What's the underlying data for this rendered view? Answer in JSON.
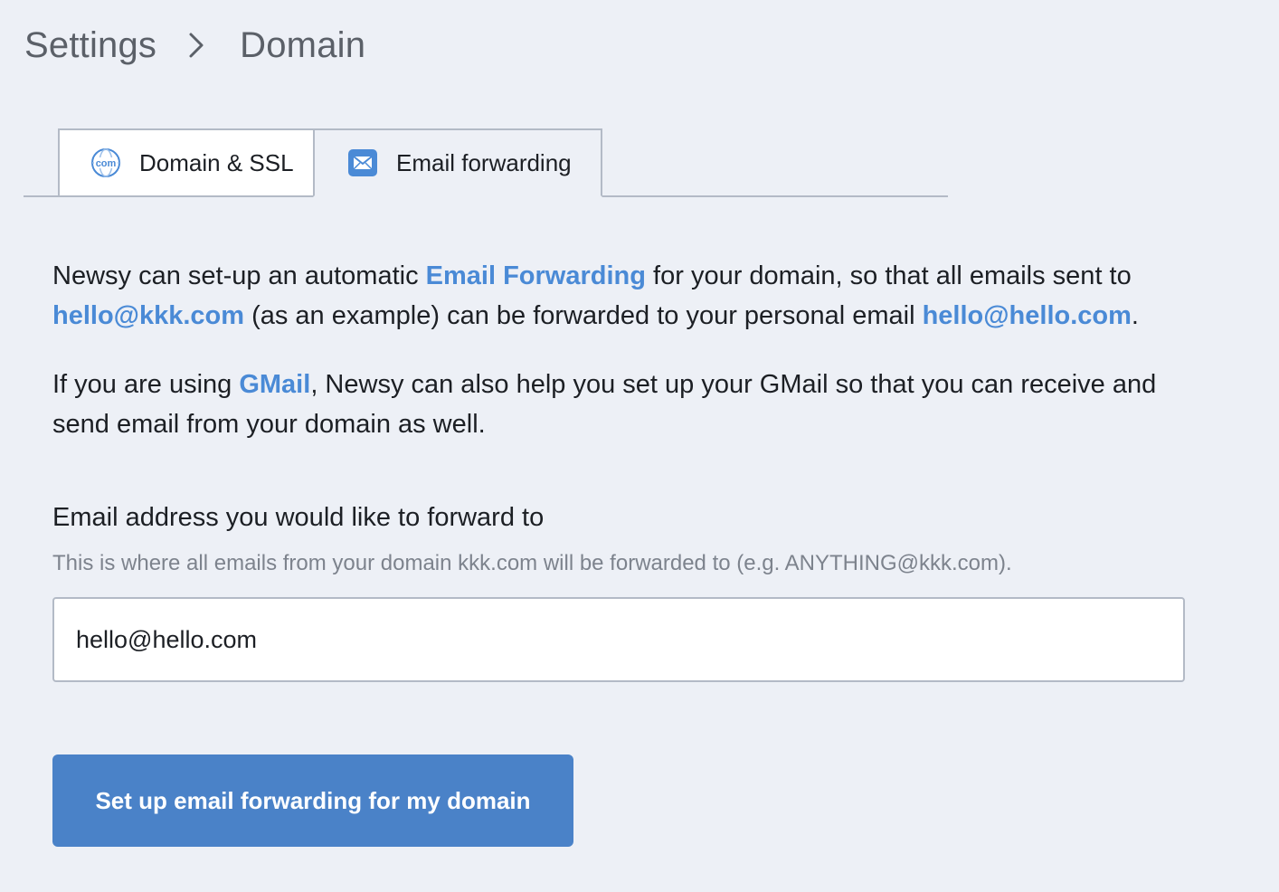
{
  "breadcrumb": {
    "parent": "Settings",
    "current": "Domain",
    "separator_icon": "chevron-right-icon"
  },
  "tabs": [
    {
      "label": "Domain & SSL",
      "icon": "globe-com-icon",
      "active": false
    },
    {
      "label": "Email forwarding",
      "icon": "envelope-icon",
      "active": true
    }
  ],
  "intro": {
    "p1_a": "Newsy can set-up an automatic ",
    "p1_link1": "Email Forwarding",
    "p1_b": " for your domain, so that all emails sent to ",
    "p1_link2": "hello@kkk.com",
    "p1_c": " (as an example) can be forwarded to your personal email ",
    "p1_link3": "hello@hello.com",
    "p1_d": ".",
    "p2_a": "If you are using ",
    "p2_link": "GMail",
    "p2_b": ", Newsy can also help you set up your GMail so that you can receive and send email from your domain as well."
  },
  "form": {
    "label": "Email address you would like to forward to",
    "help": "This is where all emails from your domain kkk.com will be forwarded to (e.g. ANYTHING@kkk.com).",
    "value": "hello@hello.com"
  },
  "button": {
    "label": "Set up email forwarding for my domain"
  },
  "colors": {
    "accent": "#4a8ad6",
    "button": "#4a82c8",
    "background": "#edf0f6",
    "border": "#b3bac6"
  }
}
